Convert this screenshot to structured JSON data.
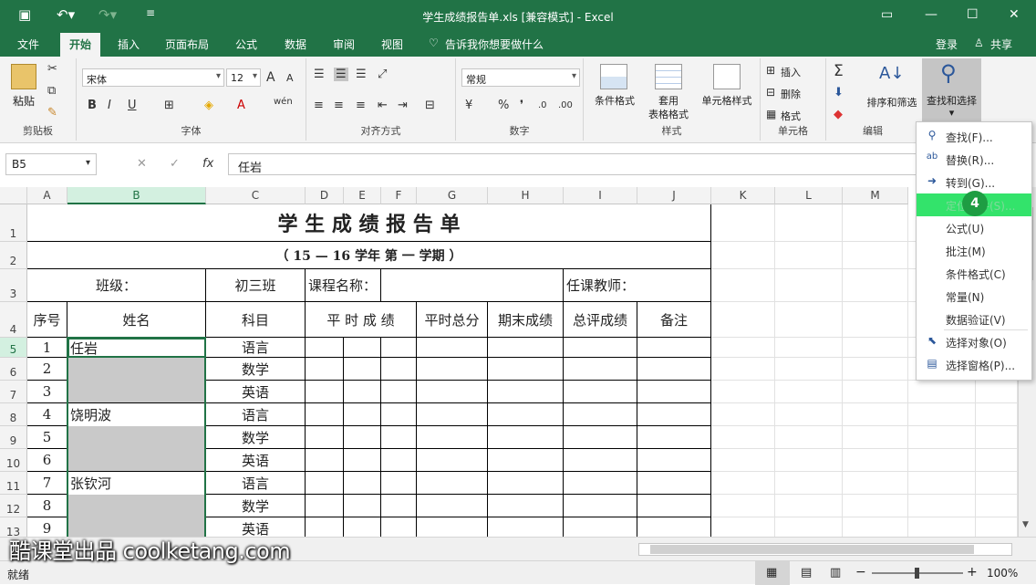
{
  "window": {
    "title": "学生成绩报告单.xls  [兼容模式] - Excel"
  },
  "tabs": [
    {
      "label": "文件",
      "active": false
    },
    {
      "label": "开始",
      "active": true
    },
    {
      "label": "插入",
      "active": false
    },
    {
      "label": "页面布局",
      "active": false
    },
    {
      "label": "公式",
      "active": false
    },
    {
      "label": "数据",
      "active": false
    },
    {
      "label": "审阅",
      "active": false
    },
    {
      "label": "视图",
      "active": false
    }
  ],
  "tell_me": "告诉我你想要做什么",
  "login": "登录",
  "share": "共享",
  "ribbon": {
    "clipboard": {
      "label": "剪贴板",
      "paste": "粘贴"
    },
    "font": {
      "label": "字体",
      "name": "宋体",
      "size": "12"
    },
    "alignment": {
      "label": "对齐方式"
    },
    "number": {
      "label": "数字",
      "format": "常规"
    },
    "styles": {
      "label": "样式",
      "cond": "条件格式",
      "table1": "套用",
      "table2": "表格格式",
      "cell": "单元格样式"
    },
    "cells": {
      "label": "单元格",
      "insert": "插入",
      "delete": "删除",
      "format": "格式"
    },
    "editing": {
      "label": "编辑",
      "sort": "排序和筛选",
      "find": "查找和选择"
    }
  },
  "namebox": "B5",
  "formula": "任岩",
  "columns": [
    "A",
    "B",
    "C",
    "D",
    "E",
    "F",
    "G",
    "H",
    "I",
    "J",
    "K",
    "L",
    "M"
  ],
  "rows": [
    "1",
    "2",
    "3",
    "4",
    "5",
    "6",
    "7",
    "8",
    "9",
    "10",
    "11",
    "12",
    "13"
  ],
  "sheet": {
    "title": "学 生 成 绩 报 告 单",
    "term": "（ 15 — 16    学年 第 一 学期 ）",
    "class_label": "班级：",
    "class_value": "初三班",
    "course_label": "课程名称：",
    "teacher_label": "任课教师：",
    "headers": {
      "no": "序号",
      "name": "姓名",
      "subject": "科目",
      "usual": "平 时 成 绩",
      "usual_total": "平时总分",
      "final": "期末成绩",
      "total": "总评成绩",
      "note": "备注"
    },
    "records": [
      {
        "no": "1",
        "name": "任岩",
        "subject": "语言"
      },
      {
        "no": "2",
        "name": "",
        "subject": "数学"
      },
      {
        "no": "3",
        "name": "",
        "subject": "英语"
      },
      {
        "no": "4",
        "name": "饶明波",
        "subject": "语言"
      },
      {
        "no": "5",
        "name": "",
        "subject": "数学"
      },
      {
        "no": "6",
        "name": "",
        "subject": "英语"
      },
      {
        "no": "7",
        "name": "张钦河",
        "subject": "语言"
      },
      {
        "no": "8",
        "name": "",
        "subject": "数学"
      },
      {
        "no": "9",
        "name": "",
        "subject": "英语"
      }
    ]
  },
  "menu": {
    "items": [
      {
        "label": "查找(F)...",
        "icon": "search-icon"
      },
      {
        "label": "替换(R)...",
        "icon": "replace-icon"
      },
      {
        "label": "转到(G)...",
        "icon": "arrow-right-icon"
      },
      {
        "label": "定位条件(S)...",
        "icon": "none",
        "highlight": true
      },
      {
        "label": "公式(U)",
        "icon": "none"
      },
      {
        "label": "批注(M)",
        "icon": "none"
      },
      {
        "label": "条件格式(C)",
        "icon": "none"
      },
      {
        "label": "常量(N)",
        "icon": "none"
      },
      {
        "label": "数据验证(V)",
        "icon": "none"
      },
      {
        "label": "选择对象(O)",
        "icon": "cursor-icon"
      },
      {
        "label": "选择窗格(P)...",
        "icon": "pane-icon"
      }
    ]
  },
  "badge": "4",
  "status": {
    "ready": "就绪",
    "zoom": "100%"
  },
  "watermark": "酷课堂出品 coolketang.com"
}
